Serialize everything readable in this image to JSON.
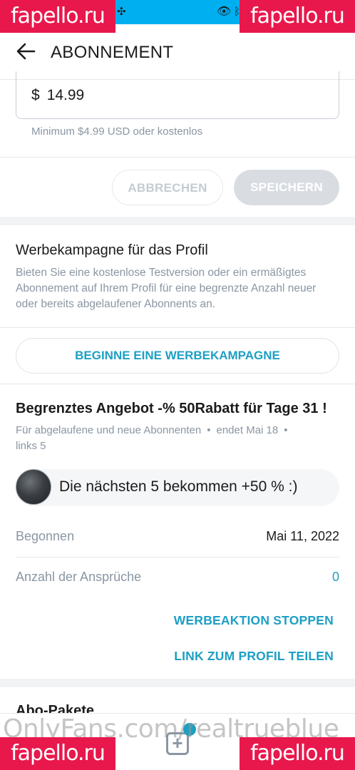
{
  "header": {
    "title": "ABONNEMENT"
  },
  "watermarks": {
    "badge": "fapello.ru",
    "overlay": "OnlyFans.com/realtrueblue"
  },
  "price": {
    "currency": "$",
    "value": "14.99",
    "hint": "Minimum $4.99 USD oder kostenlos"
  },
  "actions": {
    "cancel_label": "ABBRECHEN",
    "save_label": "SPEICHERN"
  },
  "promo": {
    "title": "Werbekampagne für das Profil",
    "description": "Bieten Sie eine kostenlose Testversion oder ein ermäßigtes Abonnement auf Ihrem Profil für eine begrenzte Anzahl neuer oder bereits abgelaufener Abonnents an.",
    "start_label": "BEGINNE EINE WERBEKAMPAGNE"
  },
  "offer": {
    "title": "Begrenztes Angebot -% 50Rabatt für Tage 31 !",
    "audience": "Für abgelaufene und neue Abonnenten",
    "ends": "endet Mai 18",
    "remaining": "links 5",
    "message": "Die nächsten 5 bekommen +50 % :)",
    "started_label": "Begonnen",
    "started_value": "Mai 11, 2022",
    "claims_label": "Anzahl der Ansprüche",
    "claims_value": "0",
    "stop_label": "WERBEAKTION STOPPEN",
    "share_label": "LINK ZUM PROFIL TEILEN"
  },
  "bundles": {
    "title": "Abo-Pakete"
  },
  "colors": {
    "brand": "#00aff0",
    "accent": "#1d9fc4",
    "muted": "#8a96a3",
    "watermark": "#e8184c"
  }
}
